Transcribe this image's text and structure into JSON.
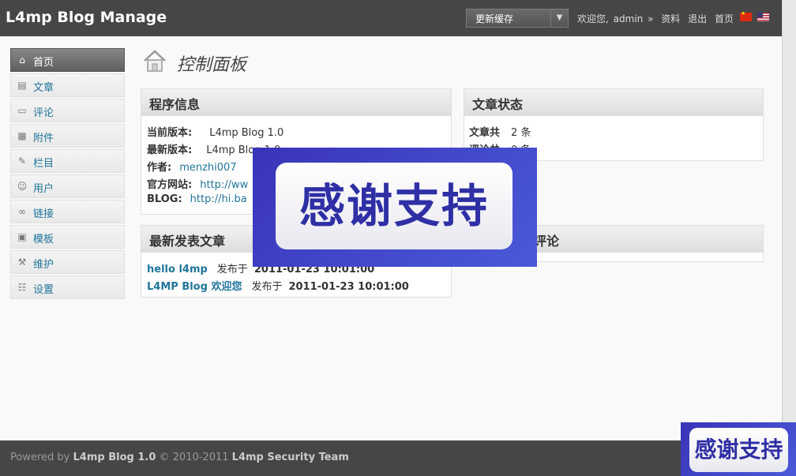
{
  "header": {
    "brand": "L4mp Blog Manage",
    "cache_select": "更新缓存",
    "welcome": "欢迎您,",
    "user": "admin",
    "sep": "»",
    "profile": "资料",
    "logout": "退出",
    "home": "首页"
  },
  "sidebar": {
    "items": [
      {
        "label": "首页",
        "icon": "home-icon"
      },
      {
        "label": "文章",
        "icon": "posts-icon"
      },
      {
        "label": "评论",
        "icon": "comments-icon"
      },
      {
        "label": "附件",
        "icon": "attachments-icon"
      },
      {
        "label": "栏目",
        "icon": "categories-icon"
      },
      {
        "label": "用户",
        "icon": "users-icon"
      },
      {
        "label": "链接",
        "icon": "links-icon"
      },
      {
        "label": "模板",
        "icon": "templates-icon"
      },
      {
        "label": "维护",
        "icon": "maintenance-icon"
      },
      {
        "label": "设置",
        "icon": "settings-icon"
      }
    ]
  },
  "page": {
    "title": "控制面板"
  },
  "program_info": {
    "title": "程序信息",
    "current_version_label": "当前版本:",
    "current_version": "L4mp Blog 1.0",
    "latest_version_label": "最新版本:",
    "latest_version": "L4mp Blog 1.0",
    "author_label": "作者:",
    "author": "menzhi007",
    "site_label": "官方网站:",
    "site": "http://ww",
    "blog_label": "BLOG:",
    "blog": "http://hi.ba"
  },
  "article_status": {
    "title": "文章状态",
    "posts_label": "文章共",
    "posts_value": "2 条",
    "comments_label": "评论共",
    "comments_value": "0 条"
  },
  "recent_posts": {
    "title": "最新发表文章",
    "items": [
      {
        "title": "hello l4mp",
        "pub": "发布于",
        "date": "2011-01-23 10:01:00"
      },
      {
        "title": "L4MP Blog 欢迎您",
        "pub": "发布于",
        "date": "2011-01-23 10:01:00"
      }
    ]
  },
  "recent_comments": {
    "title": "评论"
  },
  "overlay": {
    "text": "感谢支持"
  },
  "footer": {
    "powered": "Powered by",
    "product": "L4mp Blog 1.0",
    "copy": "© 2010-2011",
    "team": "L4mp Security Team"
  }
}
